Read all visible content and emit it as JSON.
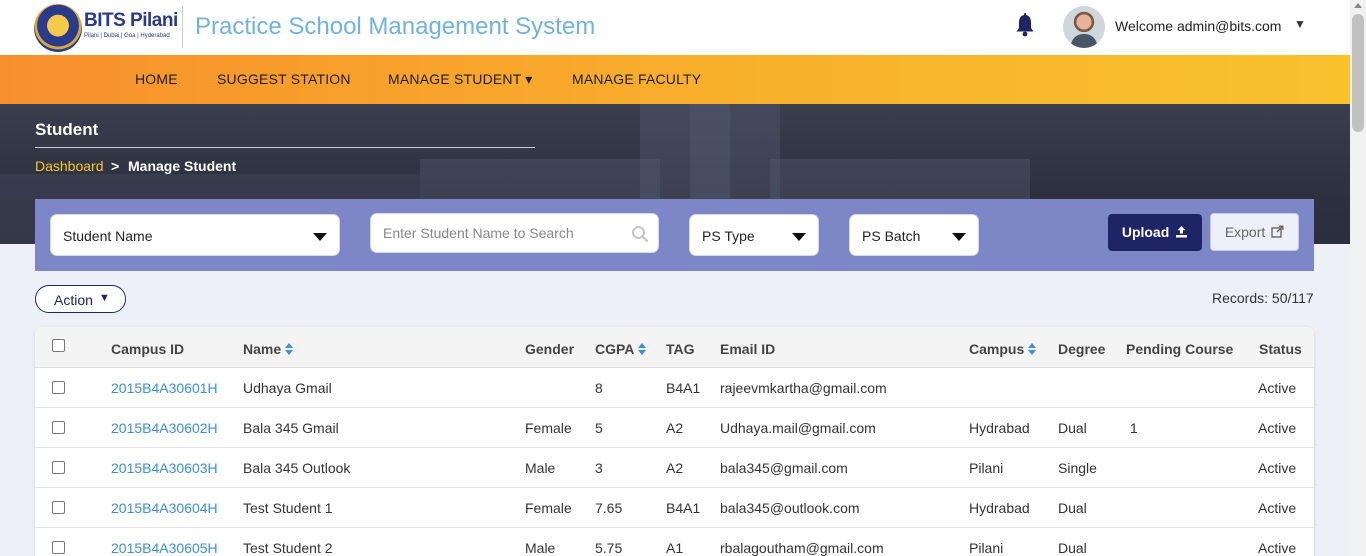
{
  "header": {
    "logo_name": "BITS Pilani",
    "logo_sub": "Pilani | Dubai | Goa | Hyderabad",
    "app_title": "Practice School Management System",
    "welcome": "Welcome admin@bits.com",
    "caret": "▼"
  },
  "nav": {
    "items": [
      "HOME",
      "SUGGEST STATION",
      "MANAGE STUDENT ▾",
      "MANAGE FACULTY"
    ]
  },
  "hero": {
    "title": "Student",
    "breadcrumb": {
      "home": "Dashboard",
      "separator": ">",
      "current": "Manage Student"
    }
  },
  "filters": {
    "student_name": "Student Name",
    "search_placeholder": "Enter Student Name to Search",
    "ps_type": "PS Type",
    "ps_batch": "PS Batch",
    "upload": "Upload",
    "export": "Export"
  },
  "toolbar": {
    "action": "Action",
    "action_caret": "▼",
    "records": "Records: 50/117"
  },
  "table": {
    "columns": [
      "Campus ID",
      "Name",
      "Gender",
      "CGPA",
      "TAG",
      "Email ID",
      "Campus",
      "Degree",
      "Pending Course",
      "Status"
    ],
    "rows": [
      {
        "campus_id": "2015B4A30601H",
        "name": "Udhaya Gmail",
        "gender": "",
        "cgpa": "8",
        "tag": "B4A1",
        "email": "rajeevmkartha@gmail.com",
        "campus": "",
        "degree": "",
        "pending": "",
        "status": "Active"
      },
      {
        "campus_id": "2015B4A30602H",
        "name": "Bala 345 Gmail",
        "gender": "Female",
        "cgpa": "5",
        "tag": "A2",
        "email": "Udhaya.mail@gmail.com",
        "campus": "Hydrabad",
        "degree": "Dual",
        "pending": "1",
        "status": "Active"
      },
      {
        "campus_id": "2015B4A30603H",
        "name": "Bala 345 Outlook",
        "gender": "Male",
        "cgpa": "3",
        "tag": "A2",
        "email": "bala345@gmail.com",
        "campus": "Pilani",
        "degree": "Single",
        "pending": "",
        "status": "Active"
      },
      {
        "campus_id": "2015B4A30604H",
        "name": "Test Student 1",
        "gender": "Female",
        "cgpa": "7.65",
        "tag": "B4A1",
        "email": "bala345@outlook.com",
        "campus": "Hydrabad",
        "degree": "Dual",
        "pending": "",
        "status": "Active"
      },
      {
        "campus_id": "2015B4A30605H",
        "name": "Test Student 2",
        "gender": "Male",
        "cgpa": "5.75",
        "tag": "A1",
        "email": "rbalagoutham@gmail.com",
        "campus": "Pilani",
        "degree": "Dual",
        "pending": "",
        "status": "Active"
      }
    ]
  },
  "colors": {
    "nav_orange": "#f7902c",
    "nav_yellow": "#f9c22d",
    "primary_navy": "#1f2466",
    "filter_bar": "#7d87c8",
    "link_blue": "#3c8fd8",
    "title_blue": "#6fb3e0"
  }
}
